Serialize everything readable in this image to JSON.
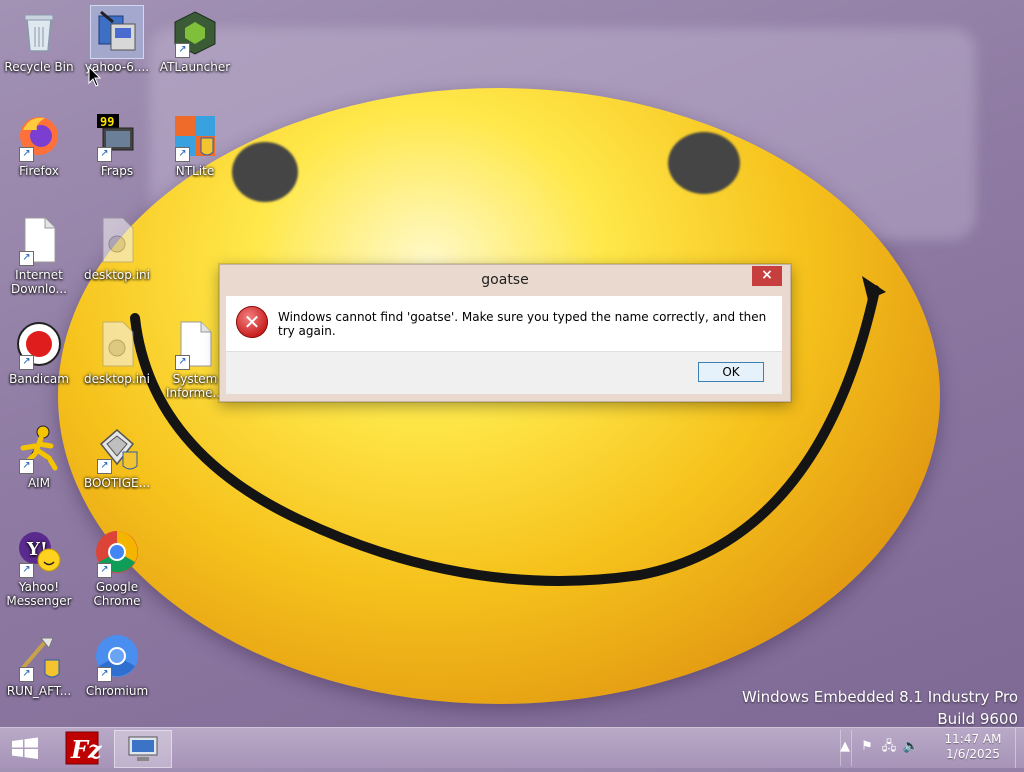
{
  "desktop_icons": [
    {
      "label": "Recycle Bin",
      "icon": "recycle-bin-icon"
    },
    {
      "label": "yahoo-6....",
      "icon": "installer-icon"
    },
    {
      "label": "ATLauncher",
      "icon": "atlauncher-icon"
    },
    {
      "label": "Firefox",
      "icon": "firefox-icon"
    },
    {
      "label": "Fraps",
      "icon": "fraps-icon"
    },
    {
      "label": "NTLite",
      "icon": "ntlite-icon"
    },
    {
      "label": "Internet Downlo...",
      "icon": "document-icon"
    },
    {
      "label": "desktop.ini",
      "icon": "ini-file-icon"
    },
    {
      "label": "Bandicam",
      "icon": "bandicam-icon"
    },
    {
      "label": "desktop.ini",
      "icon": "ini-file-icon"
    },
    {
      "label": "System Informe...",
      "icon": "document-icon"
    },
    {
      "label": "AIM",
      "icon": "aim-icon"
    },
    {
      "label": "BOOTIGE...",
      "icon": "bootice-icon"
    },
    {
      "label": "Yahoo! Messenger",
      "icon": "yahoo-messenger-icon"
    },
    {
      "label": "Google Chrome",
      "icon": "chrome-icon"
    },
    {
      "label": "RUN_AFT...",
      "icon": "run-script-icon"
    },
    {
      "label": "Chromium",
      "icon": "chromium-icon"
    }
  ],
  "dialog": {
    "title": "goatse",
    "message": "Windows cannot find 'goatse'. Make sure you typed the name correctly, and then try again.",
    "ok_label": "OK",
    "close_glyph": "×",
    "error_glyph": "✕"
  },
  "watermark": {
    "line1": "Windows Embedded 8.1 Industry Pro",
    "line2": "Build 9600"
  },
  "taskbar": {
    "items": [
      {
        "name": "filezilla",
        "icon": "filezilla-icon"
      },
      {
        "name": "remote-desktop",
        "icon": "remote-desktop-icon"
      }
    ],
    "clock": {
      "time": "11:47 AM",
      "date": "1/6/2025"
    }
  },
  "colors": {
    "close_red": "#c73e3e",
    "ok_border": "#3c7fb1",
    "smiley_yellow": "#ffe84a"
  }
}
